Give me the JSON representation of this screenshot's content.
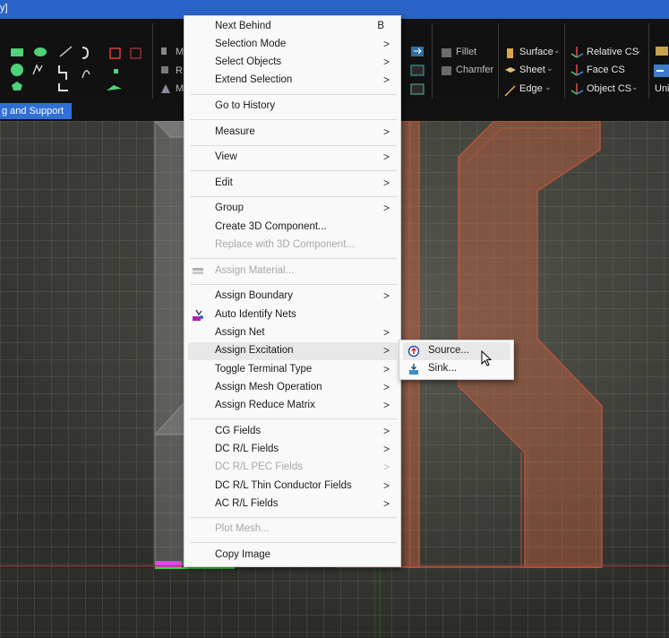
{
  "titlebar": {
    "text": "y]"
  },
  "ribbon": {
    "fillet": "Fillet",
    "chamfer": "Chamfer",
    "surface": "Surface",
    "sheet": "Sheet",
    "edge": "Edge",
    "relative_cs": "Relative CS",
    "face_cs": "Face CS",
    "object_cs": "Object CS",
    "uni": "Uni",
    "m1": "M",
    "m2": "R",
    "m3": "M",
    "active_tab": "g and Support"
  },
  "menu": {
    "items": [
      {
        "label": "Next Behind",
        "shortcut": "B"
      },
      {
        "label": "Selection Mode",
        "arrow": ">"
      },
      {
        "label": "Select Objects",
        "arrow": ">"
      },
      {
        "label": "Extend Selection",
        "arrow": ">"
      },
      {
        "label": "Go to History"
      },
      {
        "label": "Measure",
        "arrow": ">"
      },
      {
        "label": "View",
        "arrow": ">"
      },
      {
        "label": "Edit",
        "arrow": ">"
      },
      {
        "label": "Group",
        "arrow": ">"
      },
      {
        "label": "Create 3D Component..."
      },
      {
        "label": "Replace with 3D Component..."
      },
      {
        "label": "Assign Material..."
      },
      {
        "label": "Assign Boundary",
        "arrow": ">"
      },
      {
        "label": "Auto Identify Nets"
      },
      {
        "label": "Assign Net",
        "arrow": ">"
      },
      {
        "label": "Assign Excitation",
        "arrow": ">"
      },
      {
        "label": "Toggle Terminal Type",
        "arrow": ">"
      },
      {
        "label": "Assign Mesh Operation",
        "arrow": ">"
      },
      {
        "label": "Assign Reduce Matrix",
        "arrow": ">"
      },
      {
        "label": "CG Fields",
        "arrow": ">"
      },
      {
        "label": "DC R/L Fields",
        "arrow": ">"
      },
      {
        "label": "DC R/L PEC Fields",
        "arrow": ">"
      },
      {
        "label": "DC R/L Thin Conductor Fields",
        "arrow": ">"
      },
      {
        "label": "AC R/L Fields",
        "arrow": ">"
      },
      {
        "label": "Plot Mesh..."
      },
      {
        "label": "Copy Image"
      }
    ]
  },
  "submenu": {
    "items": [
      {
        "label": "Source...",
        "icon": "source-icon"
      },
      {
        "label": "Sink...",
        "icon": "sink-icon"
      }
    ]
  },
  "colors": {
    "titlebar": "#2a63c7",
    "ribbon_bg": "#111111",
    "menu_bg": "#f9f9f9",
    "highlight": "#e8e8e8",
    "disabled_text": "#a8a8a8",
    "model_fill": "#c4623f",
    "accent_blue": "#2f6fd6"
  }
}
